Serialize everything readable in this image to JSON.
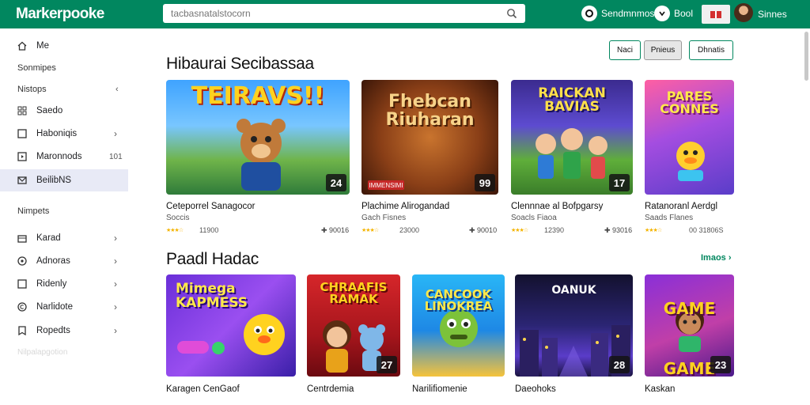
{
  "header": {
    "logo": "Markerpooke",
    "search_placeholder": "tacbasnatalstocorn",
    "items": [
      {
        "label": "Sendmnmos"
      },
      {
        "label": "Bool"
      }
    ],
    "user": "Sinnes"
  },
  "sidebar": {
    "items": [
      {
        "label": "Me",
        "icon": "home-icon"
      },
      {
        "label": "Sonmipes",
        "type": "head"
      },
      {
        "label": "Nistops",
        "type": "head",
        "chev": "‹"
      },
      {
        "label": "Saedo",
        "icon": "grid-icon"
      },
      {
        "label": "Haboniqis",
        "icon": "square-icon",
        "chev": "›"
      },
      {
        "label": "Maronnods",
        "icon": "play-square-icon",
        "count": "101"
      },
      {
        "label": "BeilibNS",
        "icon": "mail-icon",
        "active": true
      },
      {
        "label": "Nimpets",
        "type": "head"
      },
      {
        "label": "Karad",
        "icon": "box-icon",
        "chev": "›"
      },
      {
        "label": "Adnoras",
        "icon": "circle-icon",
        "chev": "›"
      },
      {
        "label": "Ridenly",
        "icon": "square-icon",
        "chev": "›"
      },
      {
        "label": "Narlidote",
        "icon": "copyright-icon",
        "chev": "›"
      },
      {
        "label": "Ropedts",
        "icon": "badge-icon",
        "chev": "›"
      }
    ],
    "faded": "Nilpalapgotion"
  },
  "section1": {
    "title": "Hibaurai Secibassaa",
    "buttons": [
      "Naci",
      "Pnieus",
      "Dhnatis"
    ],
    "cards": [
      {
        "art": "TEIRAVS!!",
        "name": "Ceteporrel Sanagocor",
        "sub": "Soccis",
        "num": "11900",
        "right": "✚ 90016",
        "badge": "24"
      },
      {
        "art": "Fhebcan Riuharan",
        "name": "Plachime Alirogandad",
        "sub": "Gach Fisnes",
        "num": "23000",
        "right": "✚ 90010",
        "badge": "99",
        "tag": "IMMENSIMI"
      },
      {
        "art": "RAICKAN BAVIAS",
        "name": "Clennnae al Bofpgarsy",
        "sub": "Soacls Fiaoa",
        "num": "12390",
        "right": "✚ 93016",
        "badge": "17"
      },
      {
        "art": "PARES CONNES",
        "name": "Ratanoranl Aerdgl",
        "sub": "Saads Flanes",
        "num": "00 31806S",
        "right": "",
        "badge": ""
      }
    ]
  },
  "section2": {
    "title": "Paadl Hadac",
    "more": "Imaos ›",
    "cards": [
      {
        "art": "Mimega KAPMESS",
        "name": "Karagen CenGaof",
        "badge": ""
      },
      {
        "art": "CHRAAFIS RAMAK",
        "name": "Centrdemia",
        "badge": "27"
      },
      {
        "art": "CANCOOK LINOKREA",
        "name": "Narilifiomenie",
        "badge": ""
      },
      {
        "art": "OANUK",
        "name": "Daeohoks",
        "badge": "28"
      },
      {
        "art": "GAME GAME",
        "name": "Kaskan",
        "badge": "23"
      }
    ]
  },
  "colors": {
    "brand": "#01875f",
    "active_nav": "#e8eaf6",
    "star": "#f4b400"
  }
}
